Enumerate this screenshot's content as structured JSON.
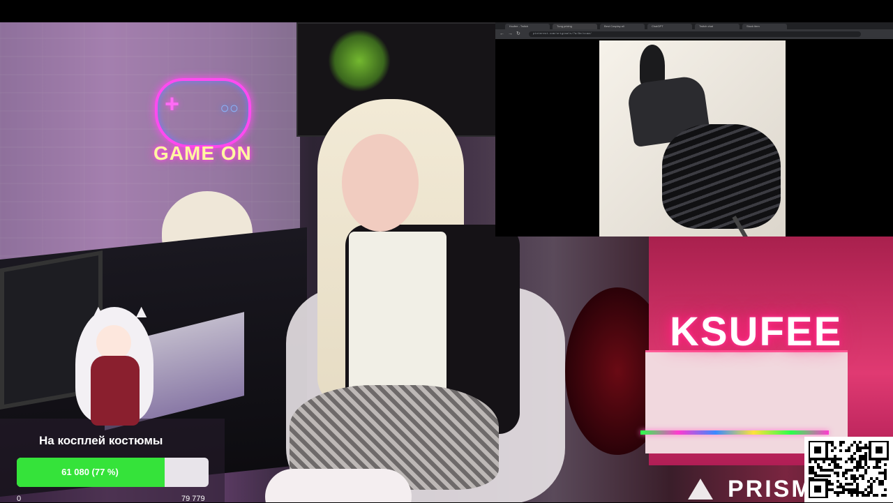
{
  "browser": {
    "tabs": [
      "Ksufee - Twitch",
      "Tung pricing",
      "Best Cosplay all",
      "ChatGPT",
      "Twitch chat",
      "Stock item"
    ],
    "address": "pinterest.com/originals/7a/8e/ccaa/"
  },
  "overlay": {
    "neon_sign_gameon": "GAME ON",
    "neon_sign_name": "KSUFEE",
    "brand": "PRISM"
  },
  "goal": {
    "title": "На косплей костюмы",
    "progress_label": "61 080 (77 %)",
    "progress_fraction": 0.77,
    "min": "0",
    "max": "79 779",
    "fill_color": "#35e33a"
  },
  "icons": {
    "qr": "qr-code-icon",
    "back": "arrow-left-icon",
    "forward": "arrow-right-icon",
    "reload": "reload-icon"
  }
}
